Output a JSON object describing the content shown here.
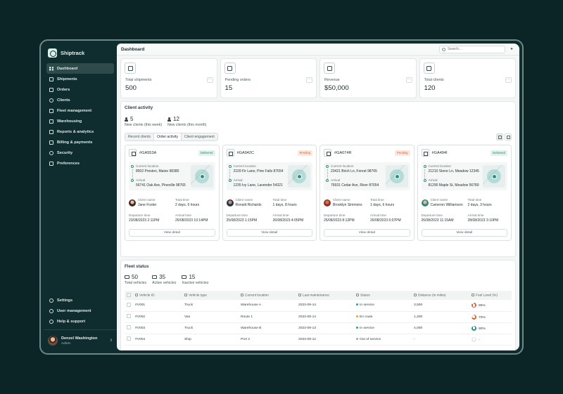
{
  "app": {
    "name": "Shiptrack"
  },
  "sidebar": {
    "items": [
      {
        "label": "Dashboard",
        "icon": "grid-icon",
        "active": true
      },
      {
        "label": "Shipments",
        "icon": "box-icon"
      },
      {
        "label": "Orders",
        "icon": "clipboard-icon"
      },
      {
        "label": "Clients",
        "icon": "users-icon"
      },
      {
        "label": "Fleet management",
        "icon": "truck-icon"
      },
      {
        "label": "Warehousing",
        "icon": "warehouse-icon"
      },
      {
        "label": "Reports & analytics",
        "icon": "chart-icon"
      },
      {
        "label": "Billing & payments",
        "icon": "card-icon"
      },
      {
        "label": "Security",
        "icon": "shield-icon"
      },
      {
        "label": "Preferences",
        "icon": "sliders-icon"
      }
    ],
    "bottom_items": [
      {
        "label": "Settings",
        "icon": "gear-icon"
      },
      {
        "label": "User management",
        "icon": "user-cog-icon"
      },
      {
        "label": "Help & support",
        "icon": "help-icon"
      }
    ],
    "user": {
      "name": "Denzel Washington",
      "role": "Admin"
    }
  },
  "header": {
    "title": "Dashboard",
    "search_placeholder": "Search..."
  },
  "stats": [
    {
      "label": "Total shipments",
      "value": "500",
      "icon": "calendar-icon"
    },
    {
      "label": "Pending orders",
      "value": "15",
      "icon": "clipboard-icon"
    },
    {
      "label": "Revenue",
      "value": "$50,000",
      "icon": "wallet-icon"
    },
    {
      "label": "Total clients",
      "value": "120",
      "icon": "user-plus-icon"
    }
  ],
  "client_activity": {
    "title": "Client activity",
    "kpis": [
      {
        "value": "5",
        "label": "New clients (this week)"
      },
      {
        "value": "12",
        "label": "New clients (this month)"
      }
    ],
    "tabs": [
      "Recent clients",
      "Order activity",
      "Client engagement"
    ],
    "active_tab": "Order activity",
    "orders": [
      {
        "id": "#GA553A",
        "status": "Delivered",
        "current_label": "Current location",
        "current": "8502 Preston, Maine 98380",
        "arrival_label": "Arrival",
        "arrival": "56741 Oak Ave, Pineville 98765",
        "client_label": "Client name",
        "client": "Jane Foster",
        "time_label": "Total time",
        "time": "2 days, 6 hours",
        "departure_label": "Departure time",
        "departure": "23/08/2023 2:11PM",
        "arrival_time_label": "Arrival time",
        "arrival_time": "25/08/2023 10:14PM",
        "button": "View detail"
      },
      {
        "id": "#GA942C",
        "status": "Pending",
        "current_label": "Current location",
        "current": "2109 Fir Lane, Pine Falls 87654",
        "arrival_label": "Arrival",
        "arrival": "1235 Ivy Lane, Lavender 54321",
        "client_label": "Client name",
        "client": "Ronald Richards",
        "time_label": "Total time",
        "time": "1 days, 8 hours",
        "departure_label": "Departure time",
        "departure": "25/08/2023 1:15PM",
        "arrival_time_label": "Arrival time",
        "arrival_time": "26/08/2023 4:05PM",
        "button": "View detail"
      },
      {
        "id": "#GA074R",
        "status": "Pending",
        "current_label": "Current location",
        "current": "23421 Birch Ln, Forest 98765",
        "arrival_label": "Arrival",
        "arrival": "76931 Cedar Ave, River 87654",
        "client_label": "Client name",
        "client": "Brooklyn Simmons",
        "time_label": "Total time",
        "time": "1 days, 6 hours",
        "departure_label": "Departure time",
        "departure": "25/08/2023 8:12PM",
        "arrival_time_label": "Arrival time",
        "arrival_time": "26/08/2023 6:07PM",
        "button": "View detail"
      },
      {
        "id": "#GA494I",
        "status": "Delivered",
        "current_label": "Current location",
        "current": "21210 Stone Ln, Meadow 12345",
        "arrival_label": "Arrival",
        "arrival": "81290 Maple St, Meadow 56789",
        "client_label": "Client name",
        "client": "Cameron Williamson",
        "time_label": "Total time",
        "time": "2 days, 3 hours",
        "departure_label": "Departure time",
        "departure": "26/08/2023 11:15AM",
        "arrival_time_label": "Arrival time",
        "arrival_time": "28/08/2023 3:10PM",
        "button": "View detail"
      }
    ]
  },
  "fleet": {
    "title": "Fleet status",
    "kpis": [
      {
        "value": "50",
        "label": "Total vehicles"
      },
      {
        "value": "35",
        "label": "Active vehicles"
      },
      {
        "value": "15",
        "label": "Inactive vehicles"
      }
    ],
    "columns": [
      "Vehicle ID",
      "Vehicle type",
      "Current location",
      "Last maintenance",
      "Status",
      "Distance (in miles)",
      "Fuel Level (%)"
    ],
    "rows": [
      {
        "id": "#V001",
        "type": "Truck",
        "location": "Warehouse A",
        "maintenance": "2023-09-14",
        "status": "In service",
        "status_color": "#2f9e6e",
        "distance": "3,500",
        "fuel": "85%",
        "fuel_value": 85,
        "fuel_color": "#e0622b"
      },
      {
        "id": "#V002",
        "type": "Van",
        "location": "Route 1",
        "maintenance": "2023-09-14",
        "status": "En route",
        "status_color": "#e0a12b",
        "distance": "1,200",
        "fuel": "70%",
        "fuel_value": 70,
        "fuel_color": "#e0622b"
      },
      {
        "id": "#V003",
        "type": "Truck",
        "location": "Warehouse B",
        "maintenance": "2023-09-13",
        "status": "In service",
        "status_color": "#2f9e6e",
        "distance": "4,000",
        "fuel": "90%",
        "fuel_value": 90,
        "fuel_color": "#2c8f87"
      },
      {
        "id": "#V004",
        "type": "Ship",
        "location": "Port 2",
        "maintenance": "2023-09-12",
        "status": "Out of service",
        "status_color": "#9aa8a7",
        "distance": "-",
        "fuel": "-",
        "fuel_value": 0,
        "fuel_color": "#c4cecd"
      }
    ]
  }
}
